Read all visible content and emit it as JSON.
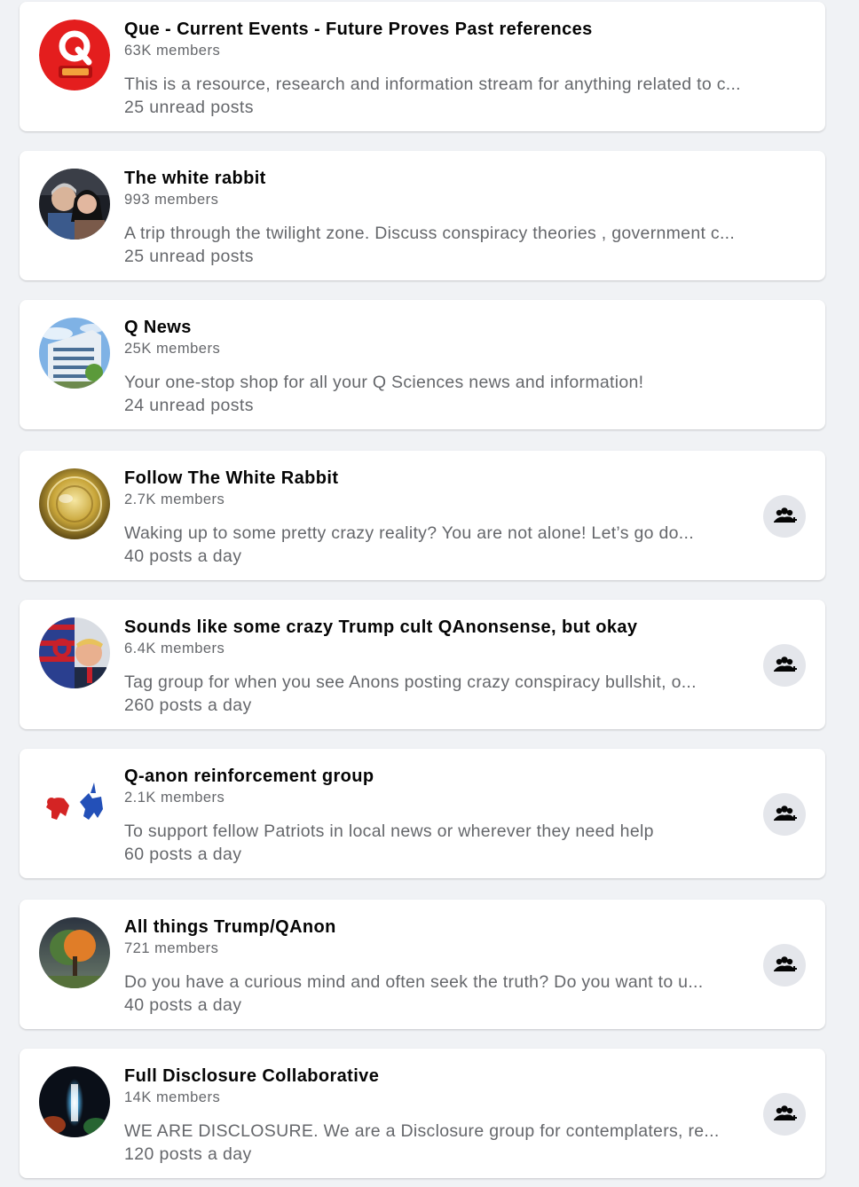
{
  "groups": [
    {
      "name": "Que - Current Events - Future Proves Past references",
      "members": "63K members",
      "description": "This is a resource, research and information stream for anything related to c...",
      "activity": "25 unread posts",
      "avatar_icon": "q-logo-red",
      "has_join": false
    },
    {
      "name": "The white rabbit",
      "members": "993 members",
      "description": "A trip through the twilight zone. Discuss conspiracy theories , government c...",
      "activity": "25 unread posts",
      "avatar_icon": "photo-two-people",
      "has_join": false
    },
    {
      "name": "Q News",
      "members": "25K members",
      "description": "Your one-stop shop for all your Q Sciences news and information!",
      "activity": "24 unread posts",
      "avatar_icon": "photo-building",
      "has_join": false
    },
    {
      "name": "Follow The White Rabbit",
      "members": "2.7K members",
      "description": "Waking up to some pretty crazy reality? You are not alone! Let’s go do...",
      "activity": "40 posts a day",
      "avatar_icon": "golden-orb",
      "has_join": true
    },
    {
      "name": "Sounds like some crazy Trump cult QAnonsense, but okay",
      "members": "6.4K members",
      "description": "Tag group for when you see Anons posting crazy conspiracy bullshit, o...",
      "activity": "260 posts a day",
      "avatar_icon": "flag-portrait",
      "has_join": true
    },
    {
      "name": "Q-anon reinforcement group",
      "members": "2.1K members",
      "description": "To support fellow Patriots in local news or wherever they need help",
      "activity": "60 posts a day",
      "avatar_icon": "elephant-donkey",
      "has_join": true
    },
    {
      "name": "All things Trump/QAnon",
      "members": "721 members",
      "description": "Do you have a curious mind and often seek the truth? Do you want to u...",
      "activity": "40 posts a day",
      "avatar_icon": "autumn-tree",
      "has_join": true
    },
    {
      "name": "Full Disclosure Collaborative",
      "members": "14K members",
      "description": "WE ARE DISCLOSURE. We are a Disclosure group for contemplaters, re...",
      "activity": "120 posts a day",
      "avatar_icon": "portal-light",
      "has_join": true
    }
  ],
  "join_button_icon": "group-add-icon",
  "colors": {
    "background": "#f0f2f5",
    "card": "#ffffff",
    "title": "#050505",
    "secondary_text": "#65676b",
    "join_button": "#e4e6eb"
  }
}
